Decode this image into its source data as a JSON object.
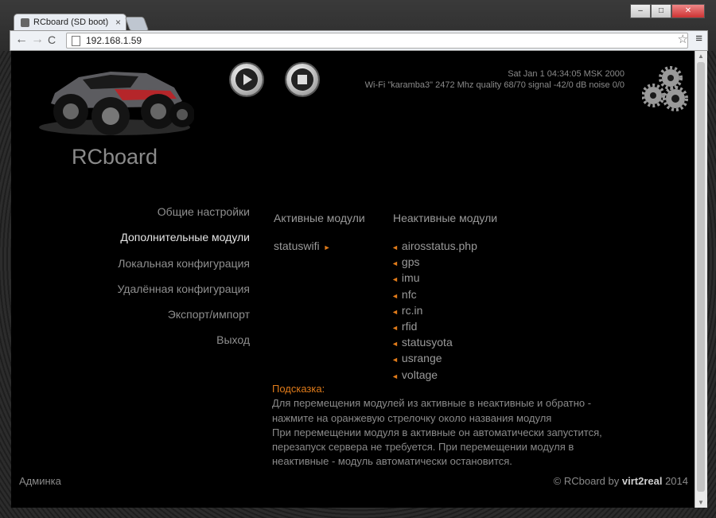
{
  "browser": {
    "tab_title": "RCboard (SD boot)",
    "tab_close": "×",
    "url": "192.168.1.59",
    "window_buttons": {
      "minimize": "–",
      "maximize": "□",
      "close": "✕"
    },
    "back": "←",
    "forward": "→",
    "reload": "C",
    "star": "☆",
    "menu": "≡"
  },
  "header": {
    "brand": "RCboard",
    "datetime": "Sat Jan 1 04:34:05 MSK 2000",
    "wifi": "Wi-Fi \"karamba3\" 2472 Mhz quality 68/70 signal -42/0 dB noise 0/0"
  },
  "nav": {
    "items": [
      {
        "label": "Общие настройки"
      },
      {
        "label": "Дополнительные модули"
      },
      {
        "label": "Локальная конфигурация"
      },
      {
        "label": "Удалённая конфигурация"
      },
      {
        "label": "Экспорт/импорт"
      },
      {
        "label": "Выход"
      }
    ]
  },
  "modules": {
    "active_title": "Активные модули",
    "inactive_title": "Неактивные модули",
    "active": [
      "statuswifi"
    ],
    "inactive": [
      "airosstatus.php",
      "gps",
      "imu",
      "nfc",
      "rc.in",
      "rfid",
      "statusyota",
      "usrange",
      "voltage"
    ],
    "arrow_left": "◄",
    "arrow_right": "►"
  },
  "hint": {
    "title": "Подсказка:",
    "lines": [
      "Для перемещения модулей из активные в неактивные и обратно -",
      "нажмите на оранжевую стрелочку около названия модуля",
      "При перемещении модуля в активные он автоматически запустится,",
      "перезапуск сервера не требуется. При перемещении модуля в",
      "неактивные - модуль автоматически остановится."
    ]
  },
  "footer": {
    "admin": "Админка",
    "copyright_prefix": "© RCboard by",
    "author": "virt2real",
    "year": "2014"
  },
  "colors": {
    "accent": "#e07b1a",
    "background": "#000000",
    "text": "#8a8a8a",
    "active_nav": "#e6e6e6"
  }
}
